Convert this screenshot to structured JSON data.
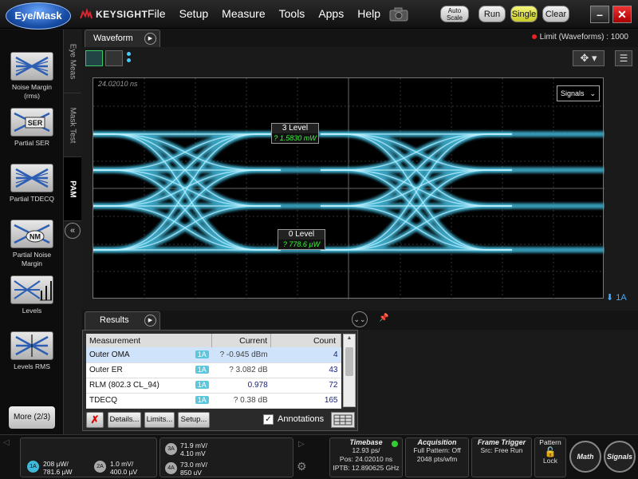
{
  "app": {
    "mode_button": "Eye/Mask",
    "brand": "KEYSIGHT",
    "menu": [
      "File",
      "Setup",
      "Measure",
      "Tools",
      "Apps",
      "Help"
    ],
    "buttons": {
      "autoscale_line1": "Auto",
      "autoscale_line2": "Scale",
      "run": "Run",
      "single": "Single",
      "clear": "Clear"
    }
  },
  "left_palette": {
    "tools": [
      {
        "label": "Noise Margin (rms)",
        "icon": "noise-margin-icon"
      },
      {
        "label": "Partial SER",
        "icon": "partial-ser-icon",
        "badge": "SER"
      },
      {
        "label": "Partial TDECQ",
        "icon": "partial-tdecq-icon"
      },
      {
        "label": "Partial Noise Margin",
        "icon": "partial-noise-margin-icon",
        "badge": "NM"
      },
      {
        "label": "Levels",
        "icon": "levels-icon"
      },
      {
        "label": "Levels RMS",
        "icon": "levels-rms-icon"
      }
    ],
    "more_button": "More (2/3)",
    "vertical_tabs": [
      "Eye Meas",
      "Mask Test",
      "PAM"
    ]
  },
  "waveform": {
    "tab": "Waveform",
    "limit_text": "Limit (Waveforms) : 1000",
    "timestamp": "24.02010 ns",
    "signals_dropdown": "Signals",
    "levels": [
      {
        "title": "3 Level",
        "value": "? 1.5830 mW"
      },
      {
        "title": "0 Level",
        "value": "? 778.6 µW"
      }
    ],
    "channel_marker": "1A"
  },
  "results": {
    "tab": "Results",
    "columns": [
      "Measurement",
      "Current",
      "Count"
    ],
    "rows": [
      {
        "name": "Outer OMA",
        "channel": "1A",
        "current": "? -0.945 dBm",
        "count": "4"
      },
      {
        "name": "Outer ER",
        "channel": "1A",
        "current": "? 3.082 dB",
        "count": "43"
      },
      {
        "name": "RLM (802.3 CL_94)",
        "channel": "1A",
        "current": "0.978",
        "count": "72"
      },
      {
        "name": "TDECQ",
        "channel": "1A",
        "current": "? 0.38 dB",
        "count": "165"
      }
    ],
    "buttons": {
      "delete": "✗",
      "details": "Details...",
      "limits": "Limits...",
      "setup": "Setup..."
    },
    "annotations_label": "Annotations"
  },
  "bottom": {
    "channel_1a": {
      "badge": "1A",
      "line1": "208 µW/",
      "line2": "781.6 µW"
    },
    "channel_2a": {
      "badge": "2A",
      "line1": "1.0 mV/",
      "line2": "400.0 µV"
    },
    "channel_3a": {
      "badge": "3A",
      "line1": "71.9 mV/",
      "line2": "4.10 mV"
    },
    "channel_4a": {
      "badge": "4A",
      "line1": "73.0 mV/",
      "line2": "850 uV"
    },
    "timebase": {
      "title": "Timebase",
      "line1": "12.93 ps/",
      "line2": "Pos: 24.02010 ns",
      "line3": "IPTB: 12.890625 GHz"
    },
    "acquisition": {
      "title": "Acquisition",
      "line1": "Full Pattern: Off",
      "line2": "2048 pts/wfm"
    },
    "frame_trigger": {
      "title": "Frame Trigger",
      "line1": "Src: Free Run"
    },
    "pattern": {
      "title": "Pattern",
      "line1": "Lock"
    },
    "math_button": "Math",
    "signals_button": "Signals"
  }
}
